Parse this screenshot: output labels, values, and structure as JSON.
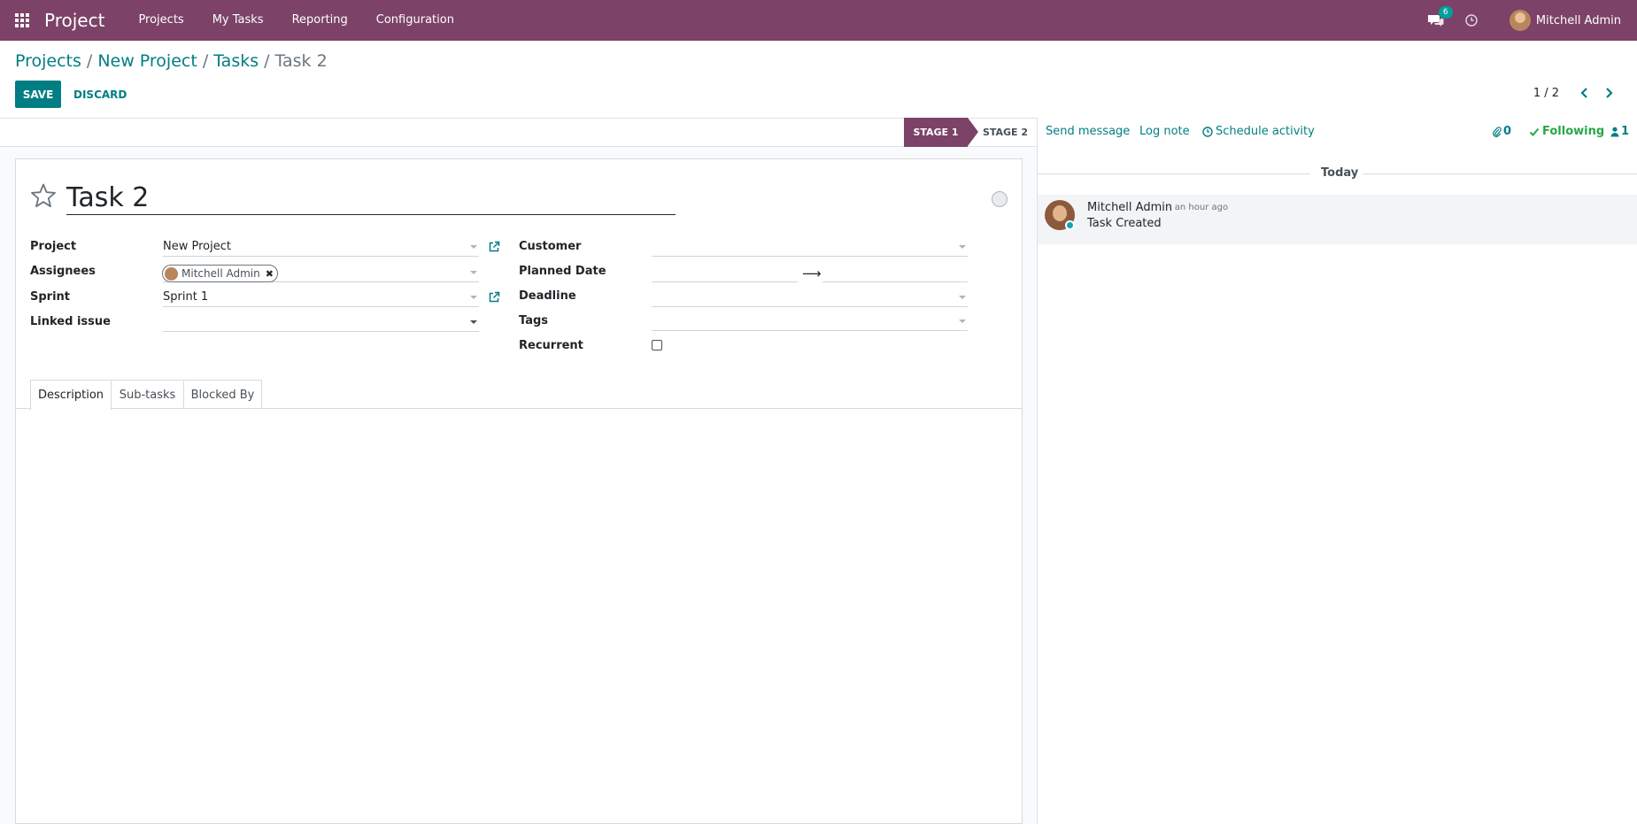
{
  "navbar": {
    "brand": "Project",
    "menu": [
      "Projects",
      "My Tasks",
      "Reporting",
      "Configuration"
    ],
    "messages_count": "6",
    "user_name": "Mitchell Admin"
  },
  "breadcrumb": {
    "items": [
      "Projects",
      "New Project",
      "Tasks"
    ],
    "separator": "/",
    "current": "Task 2"
  },
  "buttons": {
    "save": "SAVE",
    "discard": "DISCARD"
  },
  "pager": {
    "value": "1 / 2"
  },
  "stages": {
    "active": "STAGE 1",
    "next": "STAGE 2"
  },
  "form": {
    "title": "Task 2",
    "left_fields": {
      "project_label": "Project",
      "project_value": "New Project",
      "assignees_label": "Assignees",
      "assignee_tag": "Mitchell Admin",
      "sprint_label": "Sprint",
      "sprint_value": "Sprint 1",
      "linked_issue_label": "Linked issue",
      "linked_issue_value": ""
    },
    "right_fields": {
      "customer_label": "Customer",
      "customer_value": "",
      "planned_date_label": "Planned Date",
      "planned_date_start": "",
      "planned_date_end": "",
      "deadline_label": "Deadline",
      "deadline_value": "",
      "tags_label": "Tags",
      "tags_value": "",
      "recurrent_label": "Recurrent",
      "recurrent_checked": false
    },
    "tabs": [
      "Description",
      "Sub-tasks",
      "Blocked By"
    ],
    "active_tab": "Description"
  },
  "chatter": {
    "send_message": "Send message",
    "log_note": "Log note",
    "schedule_activity": "Schedule activity",
    "attachments_count": "0",
    "following": "Following",
    "followers_count": "1",
    "date_separator": "Today",
    "messages": [
      {
        "author": "Mitchell Admin",
        "time": "- an hour ago",
        "body": "Task Created"
      }
    ]
  },
  "colors": {
    "brand": "#7c4268",
    "accent": "#017e84",
    "following": "#28a745"
  }
}
